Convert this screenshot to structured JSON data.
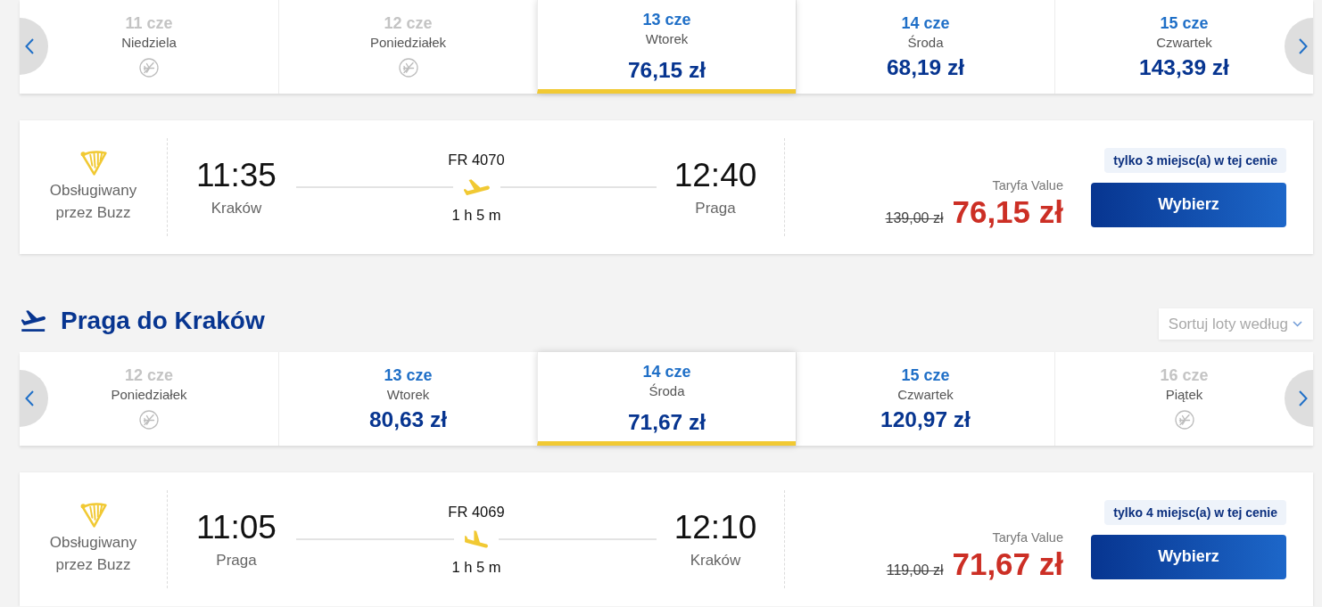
{
  "outbound": {
    "dates": [
      {
        "date": "11 cze",
        "weekday": "Niedziela",
        "available": false,
        "selected": false
      },
      {
        "date": "12 cze",
        "weekday": "Poniedziałek",
        "available": false,
        "selected": false
      },
      {
        "date": "13 cze",
        "weekday": "Wtorek",
        "price": "76,15 zł",
        "available": true,
        "selected": true
      },
      {
        "date": "14 cze",
        "weekday": "Środa",
        "price": "68,19 zł",
        "available": true,
        "selected": false
      },
      {
        "date": "15 cze",
        "weekday": "Czwartek",
        "price": "143,39 zł",
        "available": true,
        "selected": false
      }
    ],
    "flight": {
      "operator": "Obsługiwany przez Buzz",
      "departure_time": "11:35",
      "departure_city": "Kraków",
      "flight_number": "FR 4070",
      "kind": "takeoff",
      "duration": "1 h 5 m",
      "arrival_time": "12:40",
      "arrival_city": "Praga",
      "fare_name": "Taryfa Value",
      "original_price": "139,00 zł",
      "price": "76,15 zł",
      "seats_badge": "tylko 3 miejsc(a) w tej cenie",
      "button": "Wybierz"
    }
  },
  "return": {
    "title": "Praga do Kraków",
    "sort_label": "Sortuj loty według",
    "dates": [
      {
        "date": "12 cze",
        "weekday": "Poniedziałek",
        "available": false,
        "selected": false
      },
      {
        "date": "13 cze",
        "weekday": "Wtorek",
        "price": "80,63 zł",
        "available": true,
        "selected": false
      },
      {
        "date": "14 cze",
        "weekday": "Środa",
        "price": "71,67 zł",
        "available": true,
        "selected": true
      },
      {
        "date": "15 cze",
        "weekday": "Czwartek",
        "price": "120,97 zł",
        "available": true,
        "selected": false
      },
      {
        "date": "16 cze",
        "weekday": "Piątek",
        "available": false,
        "selected": false
      }
    ],
    "flight": {
      "operator": "Obsługiwany przez Buzz",
      "departure_time": "11:05",
      "departure_city": "Praga",
      "flight_number": "FR 4069",
      "kind": "landing",
      "duration": "1 h 5 m",
      "arrival_time": "12:10",
      "arrival_city": "Kraków",
      "fare_name": "Taryfa Value",
      "original_price": "119,00 zł",
      "price": "71,67 zł",
      "seats_badge": "tylko 4 miejsc(a) w tej cenie",
      "button": "Wybierz"
    }
  }
}
